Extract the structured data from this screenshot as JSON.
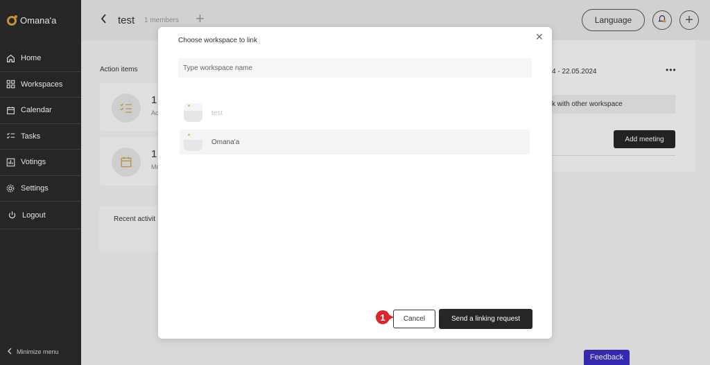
{
  "app": {
    "name": "Omana'a"
  },
  "sidebar": {
    "items": [
      {
        "label": "Home",
        "icon": "home-icon"
      },
      {
        "label": "Workspaces",
        "icon": "workspaces-icon"
      },
      {
        "label": "Calendar",
        "icon": "calendar-icon"
      },
      {
        "label": "Tasks",
        "icon": "tasks-icon"
      },
      {
        "label": "Votings",
        "icon": "votings-icon"
      },
      {
        "label": "Settings",
        "icon": "gear-icon"
      },
      {
        "label": "Logout",
        "icon": "power-icon"
      }
    ],
    "minimize_label": "Minimize menu"
  },
  "header": {
    "workspace_title": "test",
    "members_label": "1 members",
    "language_label": "Language"
  },
  "background": {
    "action_items_title": "Action items",
    "cards": [
      {
        "count": "1",
        "sub": "Ac",
        "icon": "checklist-icon"
      },
      {
        "count": "1",
        "sub": "Me",
        "icon": "calendar-icon"
      }
    ],
    "recent_title": "Recent activit",
    "date_range": "4 - 22.05.2024",
    "link_other_label": "k with other workspace",
    "add_meeting_label": "Add meeting"
  },
  "modal": {
    "title": "Choose workspace to link",
    "search_placeholder": "Type workspace name",
    "workspaces": [
      {
        "name": "test",
        "state": "disabled"
      },
      {
        "name": "Omana'a",
        "state": "selected"
      }
    ],
    "cancel_label": "Cancel",
    "send_label": "Send a linking request",
    "step_number": "1"
  },
  "feedback_label": "Feedback",
  "colors": {
    "sidebar_bg": "#2b2b2b",
    "accent_gold": "#d9a441",
    "primary_button": "#262626",
    "feedback_button": "#3b2ec4",
    "step_badge": "#d8262b"
  }
}
